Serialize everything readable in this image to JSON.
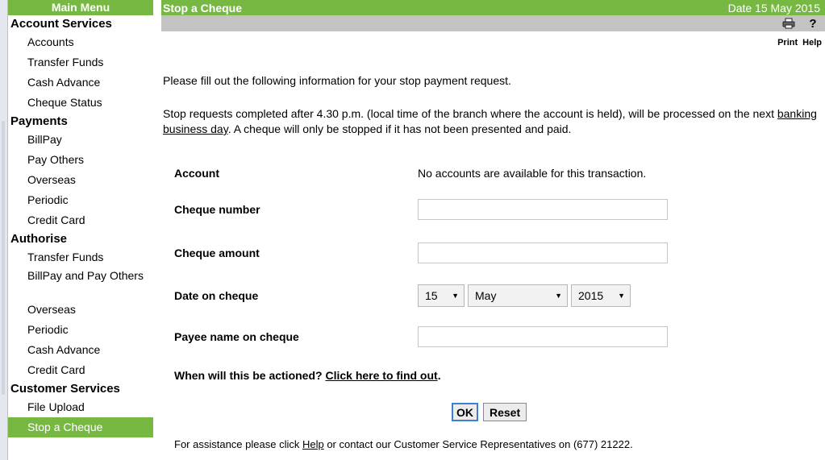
{
  "sidebar": {
    "title": "Main Menu",
    "sections": [
      {
        "label": "Account Services",
        "items": [
          "Accounts",
          "Transfer Funds",
          "Cash Advance",
          "Cheque Status"
        ]
      },
      {
        "label": "Payments",
        "items": [
          "BillPay",
          "Pay Others",
          "Overseas",
          "Periodic",
          "Credit Card"
        ]
      },
      {
        "label": "Authorise",
        "items": [
          "Transfer Funds",
          "BillPay and Pay Others",
          "Overseas",
          "Periodic",
          "Cash Advance",
          "Credit Card"
        ]
      },
      {
        "label": "Customer Services",
        "items": [
          "File Upload",
          "Stop a Cheque"
        ]
      }
    ],
    "active_item": "Stop a Cheque"
  },
  "header": {
    "title": "Stop a Cheque",
    "date": "Date 15 May 2015"
  },
  "toolbar": {
    "print_label": "Print",
    "help_label": "Help",
    "print_icon": "printer-icon",
    "help_icon": "question-icon"
  },
  "content": {
    "intro": "Please fill out the following information for your stop payment request.",
    "notice_before": "Stop requests completed after 4.30 p.m. (local time of the branch where the account is held), will be processed on the next ",
    "notice_link": "banking business day",
    "notice_after": ". A cheque will only be stopped if it has not been presented and paid."
  },
  "form": {
    "account_label": "Account",
    "account_value": "No accounts are available for this transaction.",
    "cheque_number_label": "Cheque number",
    "cheque_amount_label": "Cheque amount",
    "date_label": "Date on cheque",
    "date_day": "15",
    "date_month": "May",
    "date_year": "2015",
    "payee_label": "Payee name on cheque",
    "actioned_text": "When will this be actioned? ",
    "actioned_link": "Click here to find out",
    "actioned_end": ".",
    "ok_label": "OK",
    "reset_label": "Reset"
  },
  "footer": {
    "assist_before": "For assistance please click ",
    "assist_link": "Help",
    "assist_after": " or contact our Customer Service Representatives on (677) 21222."
  },
  "colors": {
    "accent_green": "#77b843",
    "toolbar_grey": "#c3c3c3",
    "focus_blue": "#3c7fd3"
  }
}
